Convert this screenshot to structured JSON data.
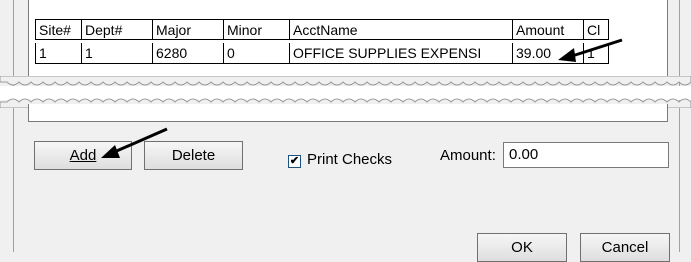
{
  "grid": {
    "columns": [
      "Site#",
      "Dept#",
      "Major",
      "Minor",
      "AcctName",
      "Amount",
      "Cl"
    ],
    "rows": [
      {
        "site": "1",
        "dept": "1",
        "major": "6280",
        "minor": "0",
        "acct_name": "OFFICE SUPPLIES EXPENSI",
        "amount": "39.00",
        "cl": "1"
      }
    ]
  },
  "buttons": {
    "add": "Add",
    "delete": "Delete",
    "ok": "OK",
    "cancel": "Cancel"
  },
  "print_checks": {
    "label": "Print Checks",
    "checked": true
  },
  "amount_field": {
    "label": "Amount:",
    "value": "0.00"
  },
  "colors": {
    "arrow": "#000000",
    "checkbox_border": "#1c5180"
  }
}
